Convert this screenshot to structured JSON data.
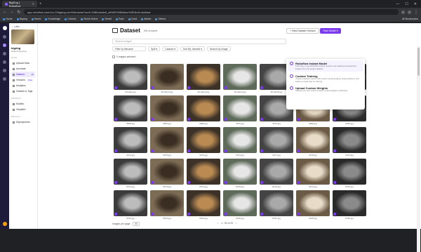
{
  "browser": {
    "tab_title": "BigDog | Roboflow",
    "url": "app.roboflow.com/ocr-2/bigdog-cnn9r/browse?sort=%5Bcreated_at%5D%5Bdesc%5D&ref=sidebar",
    "bookmarks": [
      "Home",
      "Bigdog",
      "Home",
      "Knowledge",
      "Cheese",
      "Check Home",
      "Gmail",
      "Todo",
      "Cond",
      "Admin",
      "Others"
    ],
    "bookmarks_right": "All Bookmarks"
  },
  "sidebar": {
    "back_label": "Labs",
    "project_name": "bigdog",
    "project_type": "Object Detection",
    "sections": [
      {
        "label": "DATA",
        "items": [
          {
            "label": "Upload Data",
            "icon": "upload-icon"
          },
          {
            "label": "Annotate",
            "icon": "annotate-icon"
          },
          {
            "label": "Dataset",
            "icon": "dataset-icon",
            "count": "20",
            "active": true
          },
          {
            "label": "Versions",
            "icon": "versions-icon",
            "badge": "Train"
          },
          {
            "label": "Analytics",
            "icon": "analytics-icon"
          },
          {
            "label": "Classes & Tags",
            "icon": "tag-icon"
          }
        ]
      },
      {
        "label": "MODELS",
        "items": [
          {
            "label": "Models",
            "icon": "models-icon"
          },
          {
            "label": "Visualize",
            "icon": "visualize-icon"
          }
        ]
      },
      {
        "label": "DEPLOY",
        "items": [
          {
            "label": "Deployments",
            "icon": "deploy-icon"
          }
        ]
      }
    ]
  },
  "header": {
    "title": "Dataset",
    "getback_label": "Get & export",
    "new_version_label": "+ New Dataset Version",
    "train_label": "Train Model ▾"
  },
  "search": {
    "placeholder": "Search images"
  },
  "filters": {
    "filename_placeholder": "Filter by filename",
    "split_label": "Split ▾",
    "classes_label": "Classes ▾",
    "sort_label": "Sort By: Newest ▾",
    "search_by_image_label": "Search by Image"
  },
  "selection_label": "0 images selected",
  "images": [
    {
      "name": "50-dark.jpg"
    },
    {
      "name": "50-dark2.jpg"
    },
    {
      "name": "50-dark3.jpg"
    },
    {
      "name": "50-dark4.jpg"
    },
    {
      "name": "50-dark5.jpg"
    },
    {
      "name": "50-dark6.jpg"
    },
    {
      "name": "50-dark7.jpg"
    },
    {
      "name": "8899.jpg"
    },
    {
      "name": "9981.jpg"
    },
    {
      "name": "9986.jpg"
    },
    {
      "name": "3975.jpg"
    },
    {
      "name": "3976.jpg"
    },
    {
      "name": "9899.jpg"
    },
    {
      "name": "9990.jpg"
    },
    {
      "name": "9474.jpg"
    },
    {
      "name": "9478.jpg"
    },
    {
      "name": "9475.jpg"
    },
    {
      "name": "9473.jpg"
    },
    {
      "name": "9477.jpg"
    },
    {
      "name": "9479.jpg"
    },
    {
      "name": "9476.jpg"
    },
    {
      "name": "8474.jpg"
    },
    {
      "name": "8479.jpg"
    },
    {
      "name": "8473.jpg"
    },
    {
      "name": "8478.jpg"
    },
    {
      "name": "8476.jpg"
    },
    {
      "name": "8472.jpg"
    },
    {
      "name": "8475.jpg"
    },
    {
      "name": "8432.jpg"
    },
    {
      "name": "8433.jpg"
    },
    {
      "name": "8434.jpg"
    },
    {
      "name": "8436.jpg"
    },
    {
      "name": "8437.jpg"
    },
    {
      "name": "8435.jpg"
    },
    {
      "name": "8438.jpg"
    }
  ],
  "pager": {
    "images_per_page_label": "Images per page:",
    "per_page": "50",
    "range_label": "1 - 50 of 20"
  },
  "dropdown": {
    "items": [
      {
        "title": "Roboflow Instant Model",
        "desc": "Train fast, a new Roboflow Instant model to use labeling and detection images from the project dataset."
      },
      {
        "title": "Custom Training",
        "desc": "Create a dataset version with custom preprocessing, augmentations, and select a model type for training."
      },
      {
        "title": "Upload Custom Weights",
        "desc": "Upload your own custom trained model weights to Roboflow."
      }
    ]
  },
  "colors": {
    "accent": "#7c3aed",
    "rail": "#1e1b3a"
  }
}
